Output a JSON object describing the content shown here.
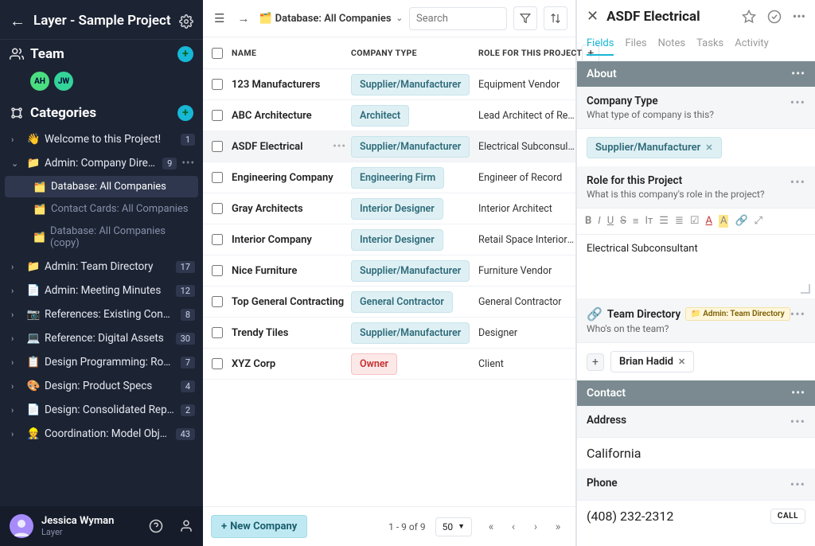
{
  "project_title": "Layer - Sample Project",
  "team": {
    "label": "Team",
    "avatars": [
      "AH",
      "JW"
    ]
  },
  "categories": {
    "label": "Categories",
    "items": [
      {
        "emoji": "👋",
        "label": "Welcome to this Project!",
        "badge": "1"
      },
      {
        "emoji": "📁",
        "label": "Admin: Company Directory",
        "badge": "9",
        "expanded": true,
        "children": [
          {
            "emoji": "🗂️",
            "label": "Database: All Companies",
            "active": true
          },
          {
            "emoji": "🗂️",
            "label": "Contact Cards: All Companies"
          },
          {
            "emoji": "🗂️",
            "label": "Database: All Companies (copy)"
          }
        ]
      },
      {
        "emoji": "📁",
        "label": "Admin: Team Directory",
        "badge": "17"
      },
      {
        "emoji": "📄",
        "label": "Admin: Meeting Minutes",
        "badge": "12"
      },
      {
        "emoji": "📷",
        "label": "References: Existing Conditions",
        "badge": "8"
      },
      {
        "emoji": "💻",
        "label": "Reference: Digital Assets",
        "badge": "30"
      },
      {
        "emoji": "📋",
        "label": "Design Programming: Rooms",
        "badge": "7"
      },
      {
        "emoji": "🎨",
        "label": "Design: Product Specs",
        "badge": "4"
      },
      {
        "emoji": "📄",
        "label": "Design: Consolidated Reports",
        "badge": "2"
      },
      {
        "emoji": "👷",
        "label": "Coordination: Model Objects",
        "badge": "43"
      }
    ]
  },
  "user": {
    "name": "Jessica Wyman",
    "org": "Layer"
  },
  "breadcrumb": {
    "emoji": "🗂️",
    "label": "Database: All Companies"
  },
  "search_placeholder": "Search",
  "table": {
    "columns": [
      "NAME",
      "COMPANY TYPE",
      "ROLE FOR THIS PROJECT"
    ],
    "rows": [
      {
        "name": "123 Manufacturers",
        "type": "Supplier/Manufacturer",
        "type_color": "blue",
        "role": "Equipment Vendor"
      },
      {
        "name": "ABC Architecture",
        "type": "Architect",
        "type_color": "blue",
        "role": "Lead Architect of Record"
      },
      {
        "name": "ASDF Electrical",
        "type": "Supplier/Manufacturer",
        "type_color": "blue",
        "role": "Electrical Subconsultant",
        "selected": true
      },
      {
        "name": "Engineering Company",
        "type": "Engineering Firm",
        "type_color": "blue",
        "role": "Engineer of Record"
      },
      {
        "name": "Gray Architects",
        "type": "Interior Designer",
        "type_color": "blue",
        "role": "Interior Architect"
      },
      {
        "name": "Interior Company",
        "type": "Interior Designer",
        "type_color": "blue",
        "role": "Retail Space Interior Architect"
      },
      {
        "name": "Nice Furniture",
        "type": "Supplier/Manufacturer",
        "type_color": "blue",
        "role": "Furniture Vendor"
      },
      {
        "name": "Top General Contracting",
        "type": "General Contractor",
        "type_color": "blue",
        "role": "General Contractor"
      },
      {
        "name": "Trendy Tiles",
        "type": "Supplier/Manufacturer",
        "type_color": "blue",
        "role": "Designer"
      },
      {
        "name": "XYZ Corp",
        "type": "Owner",
        "type_color": "red",
        "role": "Client"
      }
    ],
    "new_btn": "New Company",
    "page_info": "1 - 9 of 9",
    "page_size": "50"
  },
  "panel": {
    "title": "ASDF Electrical",
    "tabs": [
      "Fields",
      "Files",
      "Notes",
      "Tasks",
      "Activity"
    ],
    "active_tab": 0,
    "sections": {
      "about": "About",
      "contact": "Contact"
    },
    "company_type": {
      "title": "Company Type",
      "sub": "What type of company is this?",
      "value": "Supplier/Manufacturer"
    },
    "role": {
      "title": "Role for this Project",
      "sub": "What is this company's role in the project?",
      "value": "Electrical Subconsultant"
    },
    "team_dir": {
      "icon": "🔗",
      "title": "Team Directory",
      "tag_icon": "📁",
      "tag": "Admin: Team Directory",
      "sub": "Who's on the team?",
      "member": "Brian Hadid"
    },
    "address": {
      "title": "Address",
      "value": "California"
    },
    "phone": {
      "title": "Phone",
      "value": "(408) 232-2312",
      "btn": "CALL"
    }
  }
}
